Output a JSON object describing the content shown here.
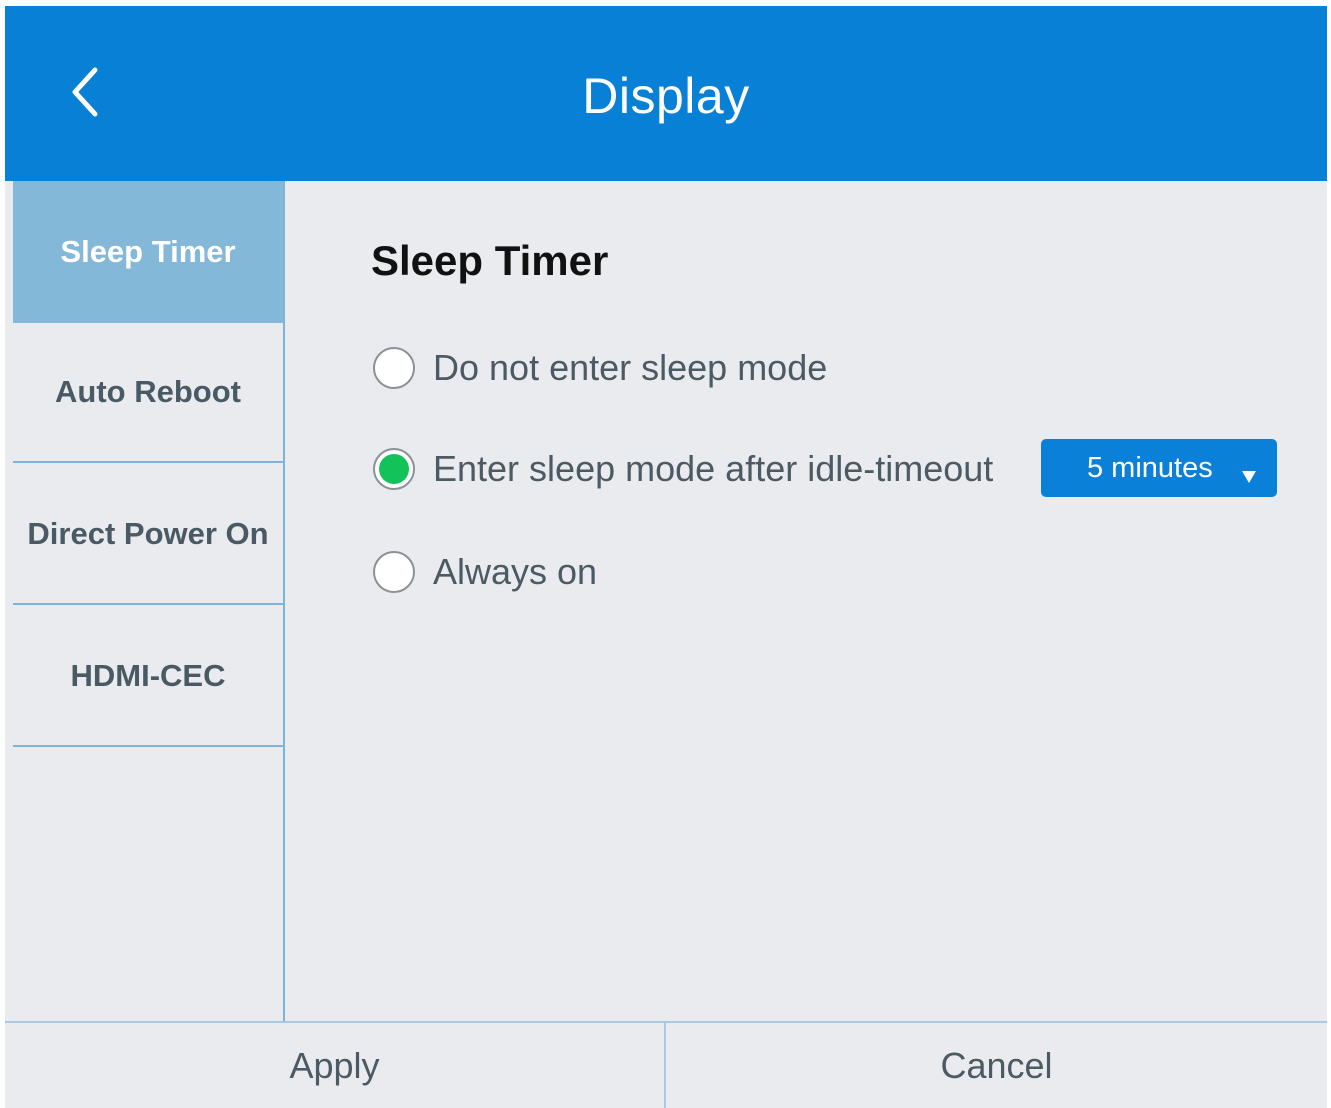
{
  "header": {
    "title": "Display",
    "back_icon": "chevron-left-icon"
  },
  "sidebar": {
    "items": [
      {
        "label": "Sleep Timer",
        "active": true
      },
      {
        "label": "Auto Reboot",
        "active": false
      },
      {
        "label": "Direct Power On",
        "active": false
      },
      {
        "label": "HDMI-CEC",
        "active": false
      }
    ]
  },
  "main": {
    "section_title": "Sleep Timer",
    "options": [
      {
        "label": "Do not enter sleep mode",
        "selected": false
      },
      {
        "label": "Enter sleep mode after idle-timeout",
        "selected": true
      },
      {
        "label": "Always on",
        "selected": false
      }
    ],
    "timeout_select": {
      "value": "5 minutes",
      "icon": "dropdown-arrow-icon"
    }
  },
  "footer": {
    "apply_label": "Apply",
    "cancel_label": "Cancel"
  },
  "colors": {
    "header": "#0880d6",
    "sidebar_active": "#84b8d8",
    "background": "#e9ebef",
    "radio_selected": "#14c25a",
    "select_bg": "#0a80d8"
  }
}
